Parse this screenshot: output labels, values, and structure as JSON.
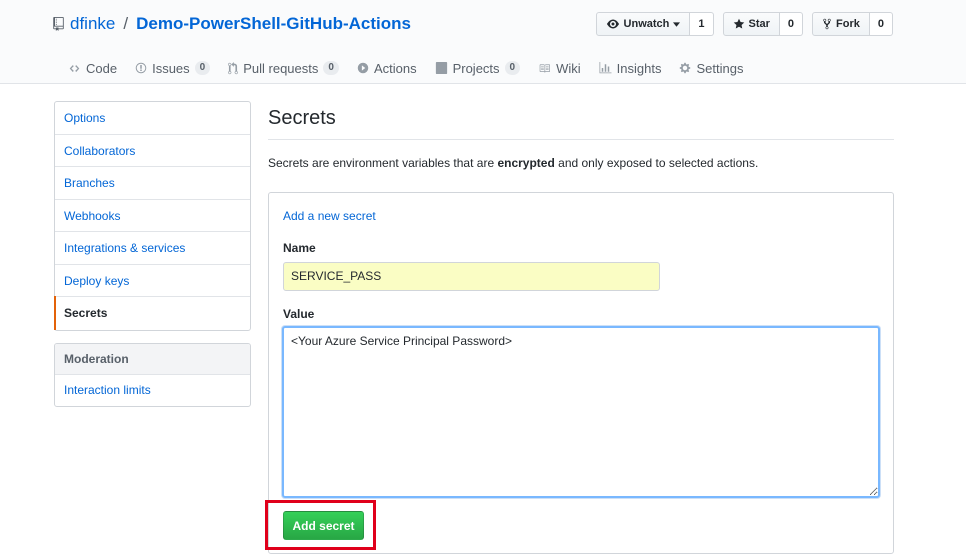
{
  "repo": {
    "owner": "dfinke",
    "separator": "/",
    "name": "Demo-PowerShell-GitHub-Actions"
  },
  "header_buttons": {
    "watch_label": "Unwatch",
    "watch_count": "1",
    "star_label": "Star",
    "star_count": "0",
    "fork_label": "Fork",
    "fork_count": "0"
  },
  "tabs": [
    {
      "label": "Code",
      "icon": "code-icon"
    },
    {
      "label": "Issues",
      "icon": "issue-icon",
      "count": "0"
    },
    {
      "label": "Pull requests",
      "icon": "pull-request-icon",
      "count": "0"
    },
    {
      "label": "Actions",
      "icon": "play-icon"
    },
    {
      "label": "Projects",
      "icon": "project-icon",
      "count": "0"
    },
    {
      "label": "Wiki",
      "icon": "book-icon"
    },
    {
      "label": "Insights",
      "icon": "graph-icon"
    },
    {
      "label": "Settings",
      "icon": "gear-icon"
    }
  ],
  "settings_menu": {
    "items": [
      {
        "label": "Options"
      },
      {
        "label": "Collaborators"
      },
      {
        "label": "Branches"
      },
      {
        "label": "Webhooks"
      },
      {
        "label": "Integrations & services"
      },
      {
        "label": "Deploy keys"
      },
      {
        "label": "Secrets"
      }
    ],
    "selected": "Secrets"
  },
  "moderation_menu": {
    "heading": "Moderation",
    "items": [
      {
        "label": "Interaction limits"
      }
    ]
  },
  "main": {
    "title": "Secrets",
    "description_prefix": "Secrets are environment variables that are ",
    "description_bold": "encrypted",
    "description_suffix": " and only exposed to selected actions.",
    "form": {
      "heading_link": "Add a new secret",
      "name_label": "Name",
      "name_value": "SERVICE_PASS",
      "value_label": "Value",
      "value_value": "<Your Azure Service Principal Password>",
      "submit_label": "Add secret"
    }
  },
  "colors": {
    "link": "#0366d6",
    "submit_green": "#28a745",
    "highlight_red": "#e0001b",
    "autofill_yellow": "#fafdc4",
    "selected_accent": "#e36209"
  }
}
